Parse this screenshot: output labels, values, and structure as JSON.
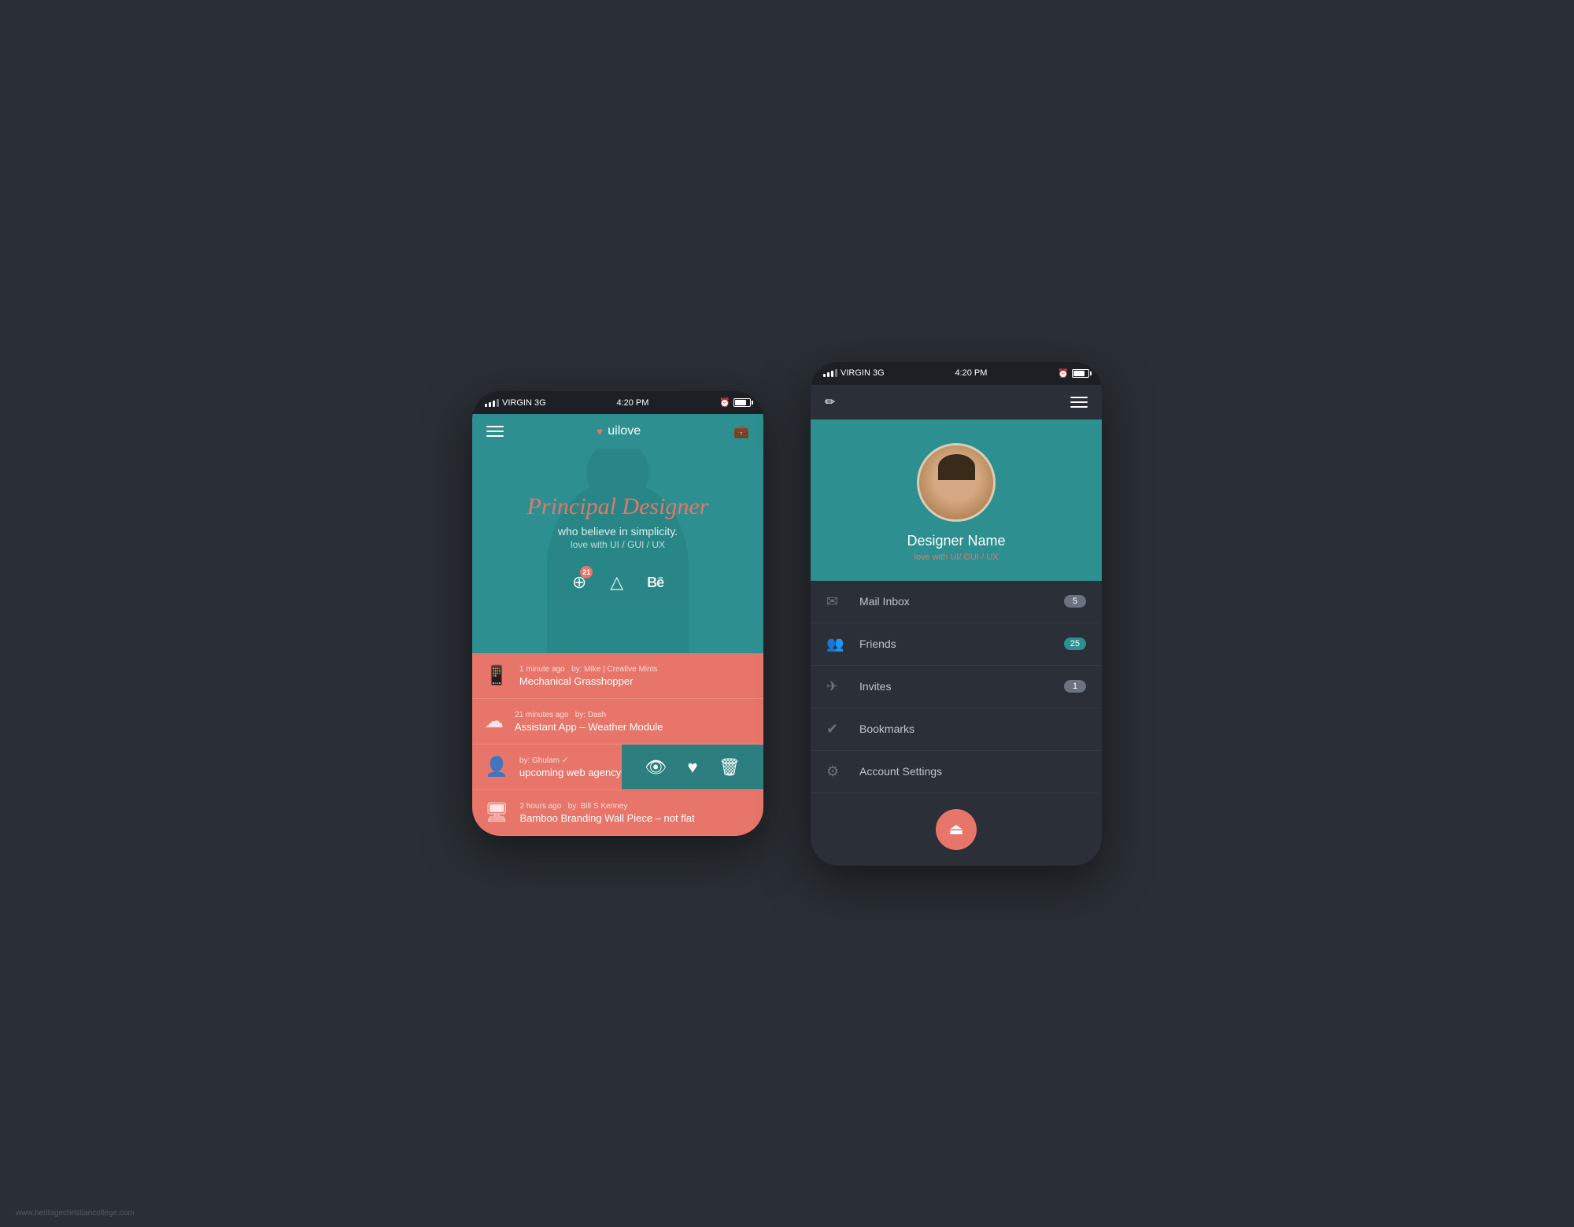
{
  "page": {
    "bg_color": "#2a2f35",
    "watermark": "www.heritagechristiancollege.com"
  },
  "phone1": {
    "status_bar": {
      "carrier": "VIRGIN  3G",
      "time": "4:20 PM"
    },
    "nav": {
      "logo_text": "uilove",
      "hamburger_label": "Menu",
      "suitcase_label": "Bag"
    },
    "hero": {
      "title_normal": "Principal",
      "title_accent": "Designer",
      "subtitle": "who believe in simplicity.",
      "tagline": "love with UI / GUI / UX"
    },
    "social": {
      "dribbble_badge": "21"
    },
    "feed": {
      "items": [
        {
          "icon": "📱",
          "time_ago": "1 minute ago",
          "by": "by: Mike | Creative Mints",
          "title": "Mechanical Grasshopper"
        },
        {
          "icon": "☁",
          "time_ago": "21 minutes ago",
          "by": "by: Dash",
          "title": "Assistant App – Weather Module"
        },
        {
          "icon": "👤",
          "time_ago": "by: Ghulam ✓",
          "by": "",
          "title": "upcoming web agency"
        },
        {
          "icon": "🖥",
          "time_ago": "2 hours ago",
          "by": "by: Bill S Kenney",
          "title": "Bamboo Branding Wall Piece – not flat"
        }
      ]
    }
  },
  "phone2": {
    "status_bar": {
      "carrier": "VIRGIN  3G",
      "time": "4:20 PM"
    },
    "profile": {
      "name": "Designer Name",
      "tagline": "love with UI/ GUI / UX"
    },
    "menu": {
      "items": [
        {
          "label": "Mail Inbox",
          "badge": "5",
          "badge_type": "gray",
          "icon": "✉"
        },
        {
          "label": "Friends",
          "badge": "25",
          "badge_type": "teal",
          "icon": "👥"
        },
        {
          "label": "Invites",
          "badge": "1",
          "badge_type": "gray",
          "icon": "✈"
        },
        {
          "label": "Bookmarks",
          "badge": "",
          "badge_type": "",
          "icon": "✔"
        },
        {
          "label": "Account Settings",
          "badge": "",
          "badge_type": "",
          "icon": "⚙"
        }
      ]
    },
    "logout_btn": "⏏"
  }
}
